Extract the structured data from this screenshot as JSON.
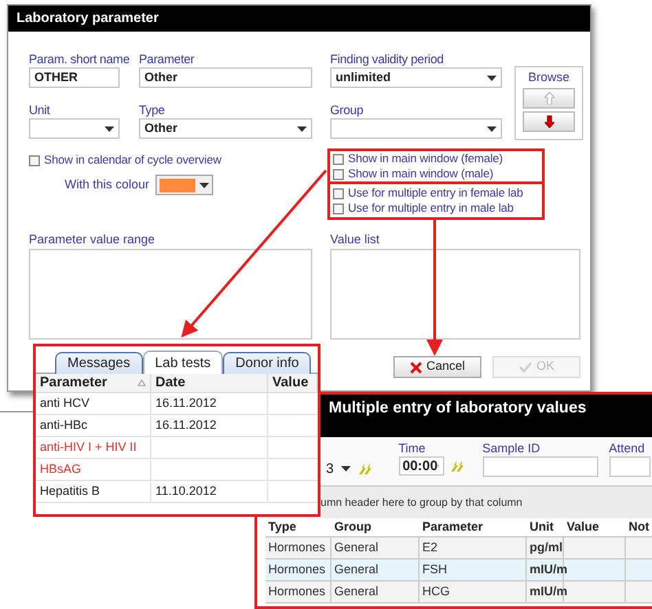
{
  "dialog": {
    "title": "Laboratory parameter",
    "fields": [
      {
        "label": "Param. short name",
        "value": "OTHER",
        "kind": "text"
      },
      {
        "label": "Parameter",
        "value": "Other",
        "kind": "text"
      },
      {
        "label": "Finding validity period",
        "value": "unlimited",
        "kind": "select"
      },
      {
        "label": "Unit",
        "kind": "select"
      },
      {
        "label": "Type",
        "value": "Other",
        "kind": "select"
      },
      {
        "label": "Group",
        "kind": "select"
      }
    ],
    "browse": {
      "label": "Browse",
      "buttons": [
        {
          "kind": "up",
          "disabled": true
        },
        {
          "kind": "down",
          "disabled": false
        }
      ]
    },
    "calendar_option": {
      "label": "Show in calendar of cycle overview",
      "checked": false
    },
    "colour": {
      "label": "With this colour",
      "color": "#ff8a3d"
    },
    "main_window_options": [
      {
        "label": "Show in main window (female)",
        "checked": false
      },
      {
        "label": "Show in main window (male)",
        "checked": false
      }
    ],
    "multiple_entry_options": [
      {
        "label": "Use for multiple entry in female lab",
        "checked": false
      },
      {
        "label": "Use for multiple entry in male lab",
        "checked": false
      }
    ],
    "value_range_label": "Parameter value range",
    "value_list_label": "Value list",
    "buttons": [
      {
        "label": "Cancel",
        "kind": "cancel",
        "disabled": false
      },
      {
        "label": "OK",
        "kind": "ok",
        "disabled": true
      }
    ]
  },
  "lab_tests_panel": {
    "tabs": [
      {
        "label": "Messages",
        "selected": false
      },
      {
        "label": "Lab tests",
        "selected": true
      },
      {
        "label": "Donor info",
        "selected": false
      }
    ],
    "columns": [
      "Parameter",
      "Date",
      "Value"
    ],
    "rows": [
      {
        "parameter": "anti HCV",
        "date": "16.11.2012",
        "flagged": false
      },
      {
        "parameter": "anti-HBc",
        "date": "16.11.2012",
        "flagged": false
      },
      {
        "parameter": "anti-HIV I + HIV II",
        "flagged": true
      },
      {
        "parameter": "HBsAG",
        "flagged": true
      },
      {
        "parameter": "Hepatitis B",
        "date": "11.10.2012",
        "flagged": false
      }
    ]
  },
  "multiple_entry_panel": {
    "title": "Multiple entry of laboratory values",
    "date_value": "3",
    "time": {
      "label": "Time",
      "value": "00:00"
    },
    "sample_id": {
      "label": "Sample ID"
    },
    "attending": {
      "label": "Attend"
    },
    "group_hint": "umn header here to group by that column",
    "columns": [
      "Type",
      "Group",
      "Parameter",
      "Unit",
      "Value",
      "Not"
    ],
    "rows": [
      {
        "cells": [
          "Hormones",
          "General",
          "E2",
          "pg/ml"
        ],
        "selected": false
      },
      {
        "cells": [
          "Hormones",
          "General",
          "FSH",
          "mIU/m"
        ],
        "selected": true
      },
      {
        "cells": [
          "Hormones",
          "General",
          "HCG",
          "mIU/m"
        ],
        "selected": false
      }
    ]
  }
}
